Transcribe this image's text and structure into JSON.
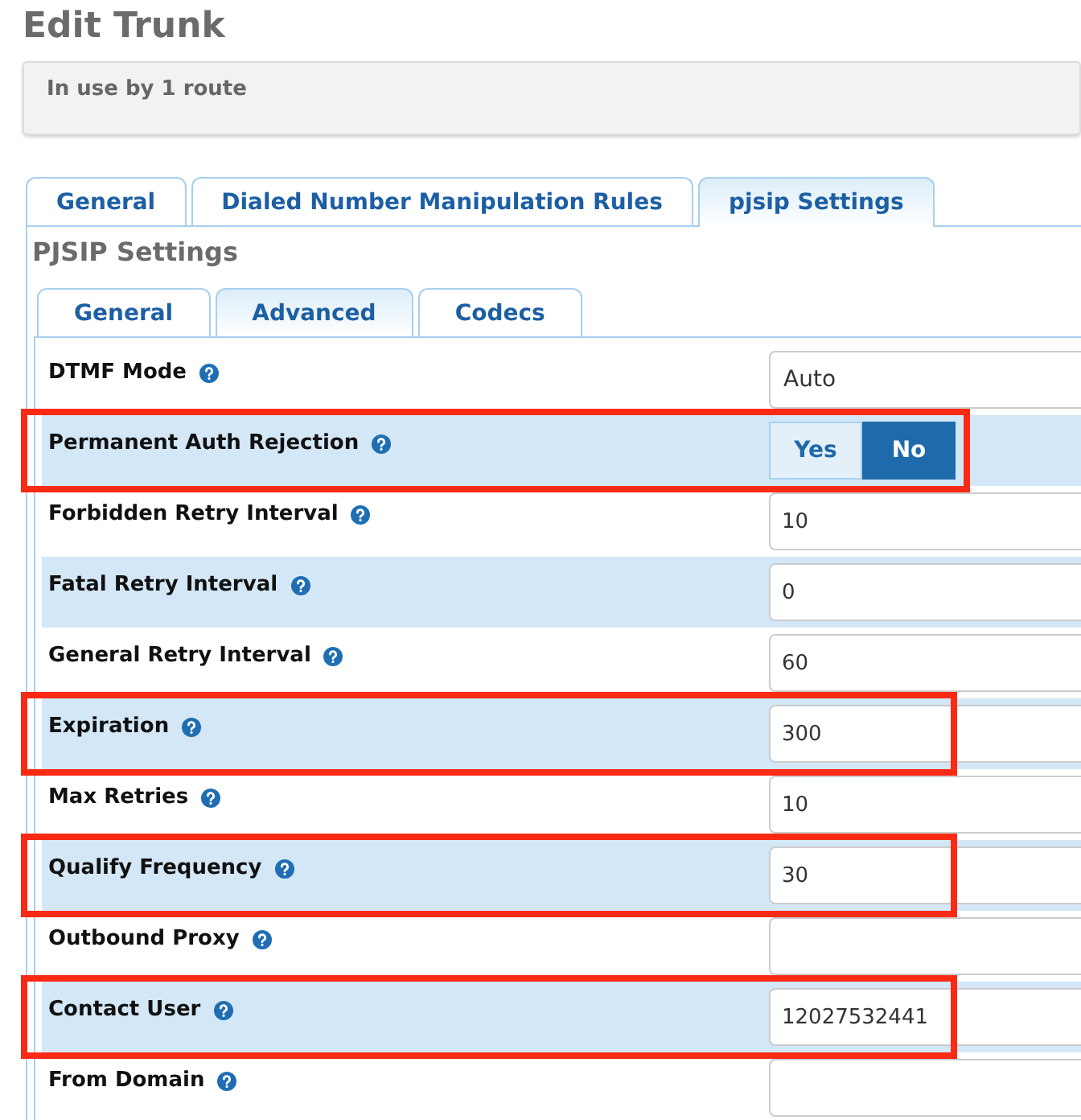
{
  "page": {
    "title": "Edit Trunk",
    "notice": "In use by 1 route"
  },
  "tabs": [
    {
      "label": "General",
      "selected": false
    },
    {
      "label": "Dialed Number Manipulation Rules",
      "selected": false
    },
    {
      "label": "pjsip Settings",
      "selected": true
    }
  ],
  "section": {
    "title": "PJSIP Settings"
  },
  "subtabs": [
    {
      "label": "General",
      "selected": false
    },
    {
      "label": "Advanced",
      "selected": true
    },
    {
      "label": "Codecs",
      "selected": false
    }
  ],
  "fields": [
    {
      "label": "DTMF Mode",
      "kind": "select",
      "value": "Auto",
      "highlighted": false
    },
    {
      "label": "Permanent Auth Rejection",
      "kind": "toggle",
      "options": [
        {
          "label": "Yes",
          "selected": false
        },
        {
          "label": "No",
          "selected": true
        }
      ],
      "highlighted": true
    },
    {
      "label": "Forbidden Retry Interval",
      "kind": "text",
      "value": "10",
      "highlighted": false
    },
    {
      "label": "Fatal Retry Interval",
      "kind": "text",
      "value": "0",
      "highlighted": false
    },
    {
      "label": "General Retry Interval",
      "kind": "text",
      "value": "60",
      "highlighted": false
    },
    {
      "label": "Expiration",
      "kind": "text",
      "value": "300",
      "highlighted": true
    },
    {
      "label": "Max Retries",
      "kind": "text",
      "value": "10",
      "highlighted": false
    },
    {
      "label": "Qualify Frequency",
      "kind": "text",
      "value": "30",
      "highlighted": true
    },
    {
      "label": "Outbound Proxy",
      "kind": "text",
      "highlighted": false
    },
    {
      "label": "Contact User",
      "kind": "text",
      "value": "12027532441",
      "highlighted": true
    },
    {
      "label": "From Domain",
      "kind": "text",
      "highlighted": false
    }
  ]
}
